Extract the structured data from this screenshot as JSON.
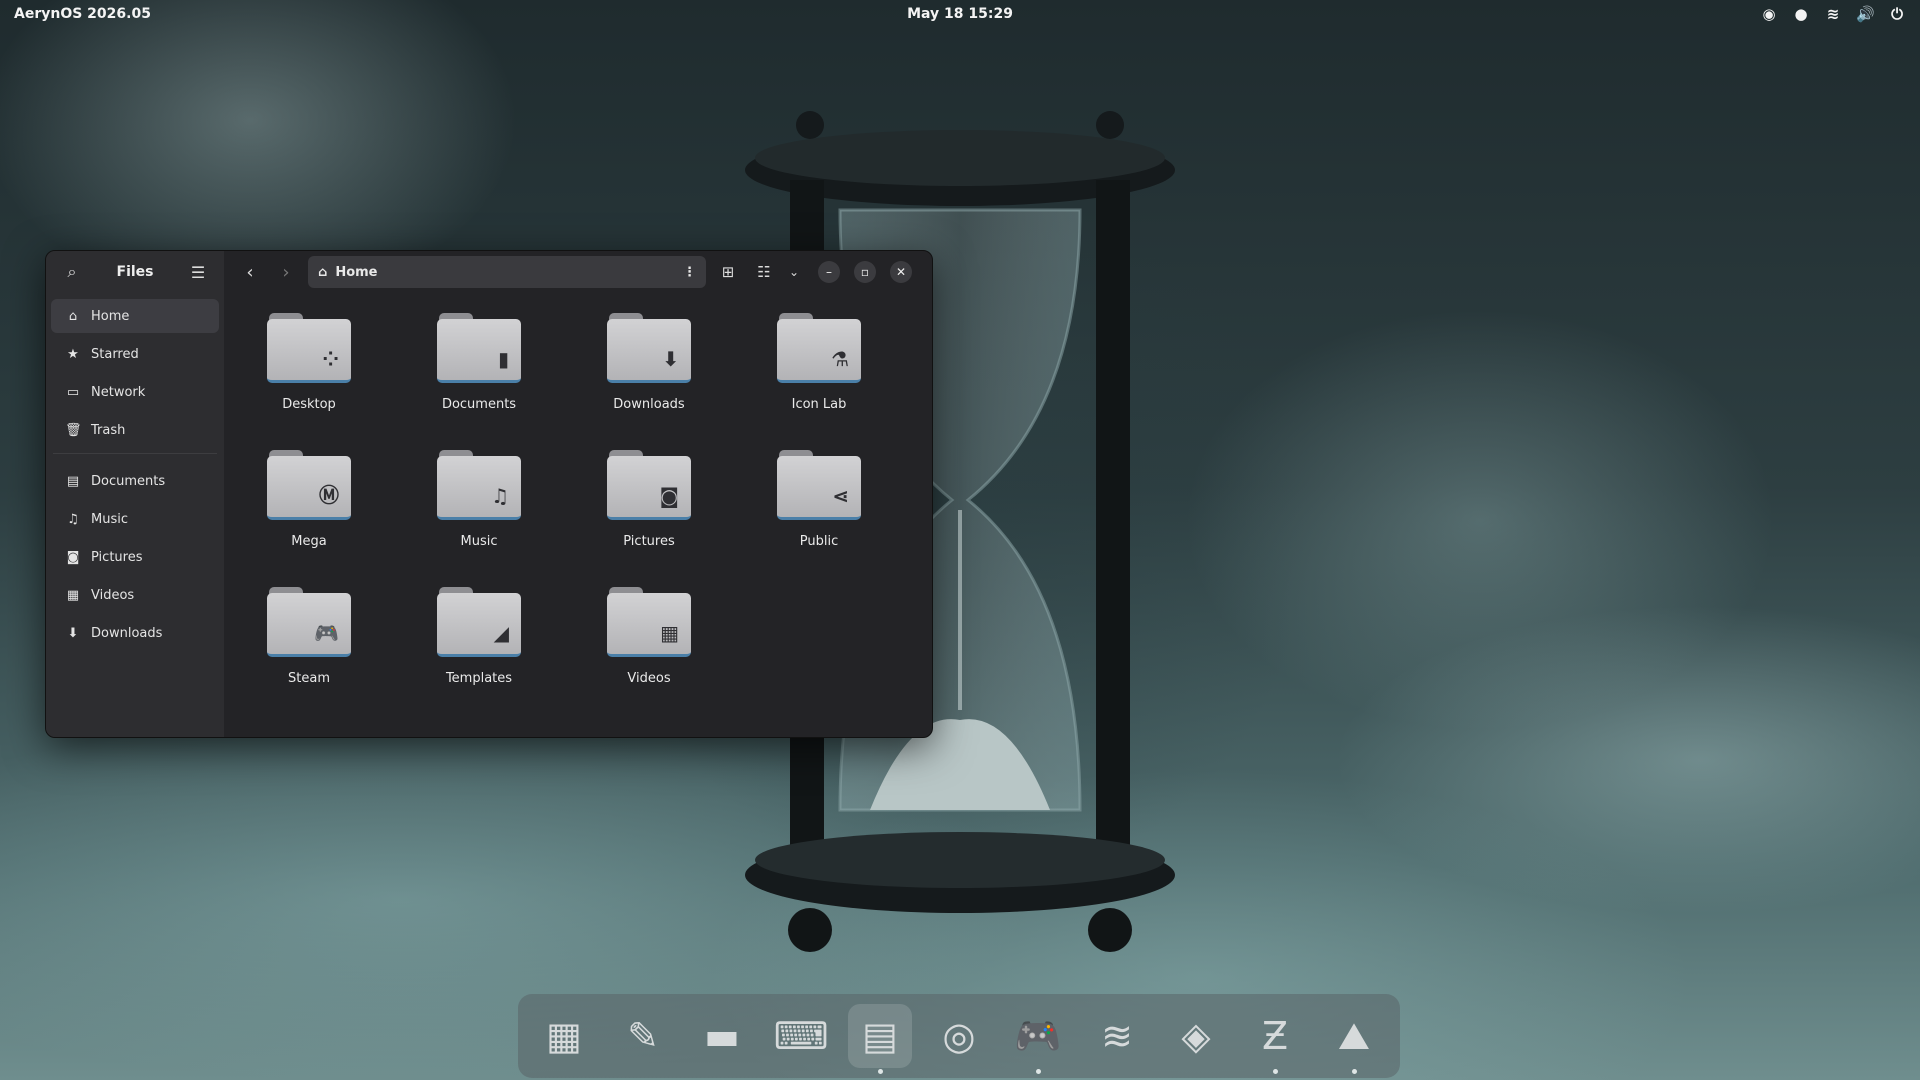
{
  "topbar": {
    "os_label": "AerynOS 2026.05",
    "datetime": "May 18  15:29",
    "tray": [
      {
        "name": "steam-tray-icon",
        "glyph": "◉"
      },
      {
        "name": "app-tray-icon",
        "glyph": "●"
      },
      {
        "name": "wifi-icon",
        "glyph": "≋"
      },
      {
        "name": "volume-icon",
        "glyph": "🔊"
      },
      {
        "name": "power-icon",
        "glyph": "⏻"
      }
    ]
  },
  "window": {
    "app_title": "Files",
    "path_label": "Home",
    "controls": {
      "minimize": "–",
      "maximize": "▫",
      "close": "✕"
    },
    "sidebar": {
      "places": [
        {
          "key": "home",
          "label": "Home",
          "icon": "⌂",
          "active": true
        },
        {
          "key": "starred",
          "label": "Starred",
          "icon": "★"
        },
        {
          "key": "network",
          "label": "Network",
          "icon": "▭"
        },
        {
          "key": "trash",
          "label": "Trash",
          "icon": "🗑"
        }
      ],
      "bookmarks": [
        {
          "key": "documents",
          "label": "Documents",
          "icon": "▤"
        },
        {
          "key": "music",
          "label": "Music",
          "icon": "♫"
        },
        {
          "key": "pictures",
          "label": "Pictures",
          "icon": "◙"
        },
        {
          "key": "videos",
          "label": "Videos",
          "icon": "▦"
        },
        {
          "key": "downloads",
          "label": "Downloads",
          "icon": "⬇"
        }
      ]
    },
    "folders": [
      {
        "key": "desktop",
        "label": "Desktop",
        "emblem": "⁘"
      },
      {
        "key": "documents",
        "label": "Documents",
        "emblem": "▮"
      },
      {
        "key": "downloads",
        "label": "Downloads",
        "emblem": "⬇"
      },
      {
        "key": "icon-lab",
        "label": "Icon Lab",
        "emblem": "⚗"
      },
      {
        "key": "mega",
        "label": "Mega",
        "emblem": "Ⓜ"
      },
      {
        "key": "music",
        "label": "Music",
        "emblem": "♫"
      },
      {
        "key": "pictures",
        "label": "Pictures",
        "emblem": "◙"
      },
      {
        "key": "public",
        "label": "Public",
        "emblem": "⋖"
      },
      {
        "key": "steam",
        "label": "Steam",
        "emblem": "🎮"
      },
      {
        "key": "templates",
        "label": "Templates",
        "emblem": "◢"
      },
      {
        "key": "videos",
        "label": "Videos",
        "emblem": "▦"
      }
    ]
  },
  "dock": [
    {
      "name": "app-grid-icon",
      "glyph": "▦",
      "active": false,
      "running": false
    },
    {
      "name": "magic-wand-icon",
      "glyph": "✎",
      "active": false,
      "running": false
    },
    {
      "name": "briefcase-icon",
      "glyph": "▬",
      "active": false,
      "running": false
    },
    {
      "name": "terminal-icon",
      "glyph": "⌨",
      "active": false,
      "running": false
    },
    {
      "name": "files-icon",
      "glyph": "▤",
      "active": true,
      "running": true
    },
    {
      "name": "browser-icon",
      "glyph": "◎",
      "active": false,
      "running": false
    },
    {
      "name": "gamepad-icon",
      "glyph": "🎮",
      "active": false,
      "running": true
    },
    {
      "name": "feed-icon",
      "glyph": "≋",
      "active": false,
      "running": false
    },
    {
      "name": "layers-icon",
      "glyph": "◈",
      "active": false,
      "running": false
    },
    {
      "name": "zed-editor-icon",
      "glyph": "Ƶ",
      "active": false,
      "running": true
    },
    {
      "name": "inkscape-icon",
      "glyph": "⛰",
      "active": false,
      "running": true
    }
  ]
}
